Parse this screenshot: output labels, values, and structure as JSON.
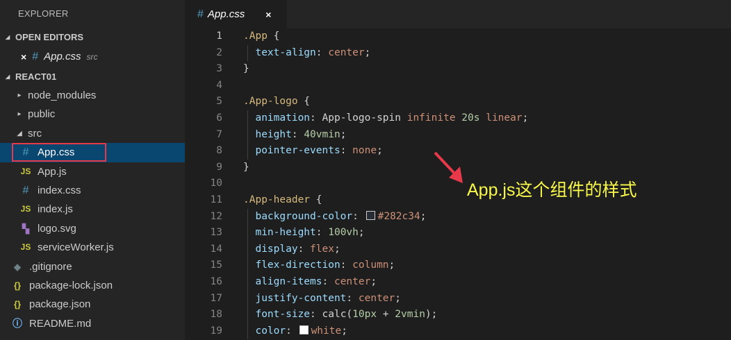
{
  "sidebar": {
    "title": "EXPLORER",
    "open_editors_label": "OPEN EDITORS",
    "open_editor": {
      "close": "×",
      "icon": "#",
      "name": "App.css",
      "desc": "src"
    },
    "project_label": "REACT01",
    "tree": [
      {
        "label": "node_modules",
        "kind": "folder",
        "icon": "",
        "depth": 1,
        "chev": "▸"
      },
      {
        "label": "public",
        "kind": "folder",
        "icon": "",
        "depth": 1,
        "chev": "▸"
      },
      {
        "label": "src",
        "kind": "folder",
        "icon": "",
        "depth": 1,
        "chev": "◢"
      },
      {
        "label": "App.css",
        "kind": "css",
        "icon": "#",
        "depth": 2,
        "selected": true
      },
      {
        "label": "App.js",
        "kind": "js",
        "icon": "JS",
        "depth": 2
      },
      {
        "label": "index.css",
        "kind": "css",
        "icon": "#",
        "depth": 2
      },
      {
        "label": "index.js",
        "kind": "js",
        "icon": "JS",
        "depth": 2
      },
      {
        "label": "logo.svg",
        "kind": "svg",
        "icon": "▚",
        "depth": 2
      },
      {
        "label": "serviceWorker.js",
        "kind": "js",
        "icon": "JS",
        "depth": 2
      },
      {
        "label": ".gitignore",
        "kind": "git",
        "icon": "◆",
        "depth": 0
      },
      {
        "label": "package-lock.json",
        "kind": "json",
        "icon": "{}",
        "depth": 0
      },
      {
        "label": "package.json",
        "kind": "json",
        "icon": "{}",
        "depth": 0
      },
      {
        "label": "README.md",
        "kind": "info",
        "icon": "ⓘ",
        "depth": 0
      }
    ]
  },
  "editor": {
    "tab": {
      "icon": "#",
      "name": "App.css",
      "close": "×"
    },
    "active_line": 1,
    "lines": [
      [
        [
          "sel",
          ".App"
        ],
        [
          "punc",
          " {"
        ]
      ],
      [
        [
          "prop",
          "  text-align"
        ],
        [
          "punc",
          ": "
        ],
        [
          "val",
          "center"
        ],
        [
          "punc",
          ";"
        ]
      ],
      [
        [
          "punc",
          "}"
        ]
      ],
      [],
      [
        [
          "sel",
          ".App-logo"
        ],
        [
          "punc",
          " {"
        ]
      ],
      [
        [
          "prop",
          "  animation"
        ],
        [
          "punc",
          ": "
        ],
        [
          "punc",
          "App-logo-spin "
        ],
        [
          "val",
          "infinite "
        ],
        [
          "num",
          "20s "
        ],
        [
          "val",
          "linear"
        ],
        [
          "punc",
          ";"
        ]
      ],
      [
        [
          "prop",
          "  height"
        ],
        [
          "punc",
          ": "
        ],
        [
          "num",
          "40vmin"
        ],
        [
          "punc",
          ";"
        ]
      ],
      [
        [
          "prop",
          "  pointer-events"
        ],
        [
          "punc",
          ": "
        ],
        [
          "val",
          "none"
        ],
        [
          "punc",
          ";"
        ]
      ],
      [
        [
          "punc",
          "}"
        ]
      ],
      [],
      [
        [
          "sel",
          ".App-header"
        ],
        [
          "punc",
          " {"
        ]
      ],
      [
        [
          "prop",
          "  background-color"
        ],
        [
          "punc",
          ": "
        ],
        [
          "swatch",
          "#282c34"
        ],
        [
          "val",
          "#282c34"
        ],
        [
          "punc",
          ";"
        ]
      ],
      [
        [
          "prop",
          "  min-height"
        ],
        [
          "punc",
          ": "
        ],
        [
          "num",
          "100vh"
        ],
        [
          "punc",
          ";"
        ]
      ],
      [
        [
          "prop",
          "  display"
        ],
        [
          "punc",
          ": "
        ],
        [
          "val",
          "flex"
        ],
        [
          "punc",
          ";"
        ]
      ],
      [
        [
          "prop",
          "  flex-direction"
        ],
        [
          "punc",
          ": "
        ],
        [
          "val",
          "column"
        ],
        [
          "punc",
          ";"
        ]
      ],
      [
        [
          "prop",
          "  align-items"
        ],
        [
          "punc",
          ": "
        ],
        [
          "val",
          "center"
        ],
        [
          "punc",
          ";"
        ]
      ],
      [
        [
          "prop",
          "  justify-content"
        ],
        [
          "punc",
          ": "
        ],
        [
          "val",
          "center"
        ],
        [
          "punc",
          ";"
        ]
      ],
      [
        [
          "prop",
          "  font-size"
        ],
        [
          "punc",
          ": "
        ],
        [
          "punc",
          "calc("
        ],
        [
          "num",
          "10px"
        ],
        [
          "punc",
          " + "
        ],
        [
          "num",
          "2vmin"
        ],
        [
          "punc",
          ");"
        ]
      ],
      [
        [
          "prop",
          "  color"
        ],
        [
          "punc",
          ": "
        ],
        [
          "swatch",
          "#ffffff"
        ],
        [
          "val",
          "white"
        ],
        [
          "punc",
          ";"
        ]
      ]
    ]
  },
  "annotation": {
    "text": "App.js这个组件的样式"
  },
  "colors": {
    "highlight_box": "#e8394b",
    "annotation": "#f8f84a",
    "selection": "#094771"
  }
}
